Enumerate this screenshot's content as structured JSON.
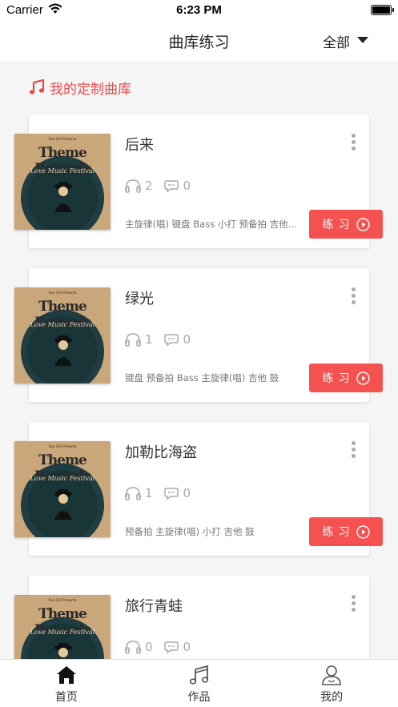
{
  "status_bar": {
    "carrier": "Carrier",
    "time": "6:23 PM"
  },
  "nav": {
    "title": "曲库练习",
    "filter_label": "全部"
  },
  "section": {
    "title": "我的定制曲库"
  },
  "cover": {
    "title": "Theme Records",
    "subtitle": "Love Music Festival"
  },
  "songs": [
    {
      "title": "后来",
      "listens": "2",
      "comments": "0",
      "tags": "主旋律(唱) 键盘 Bass 小打 预备拍 吉他...",
      "button": "练习"
    },
    {
      "title": "绿光",
      "listens": "1",
      "comments": "0",
      "tags": "键盘 预备拍 Bass 主旋律(唱) 吉他 鼓",
      "button": "练习"
    },
    {
      "title": "加勒比海盗",
      "listens": "1",
      "comments": "0",
      "tags": "预备拍 主旋律(唱) 小打 吉他 鼓",
      "button": "练习"
    },
    {
      "title": "旅行青蛙",
      "listens": "0",
      "comments": "0",
      "tags": "",
      "button": "练习"
    }
  ],
  "tabs": [
    {
      "label": "首页",
      "icon": "home-icon"
    },
    {
      "label": "作品",
      "icon": "music-note-icon"
    },
    {
      "label": "我的",
      "icon": "user-icon"
    }
  ],
  "colors": {
    "accent": "#f55151",
    "section_title": "#e94b4b",
    "background": "#f5f5f5"
  }
}
